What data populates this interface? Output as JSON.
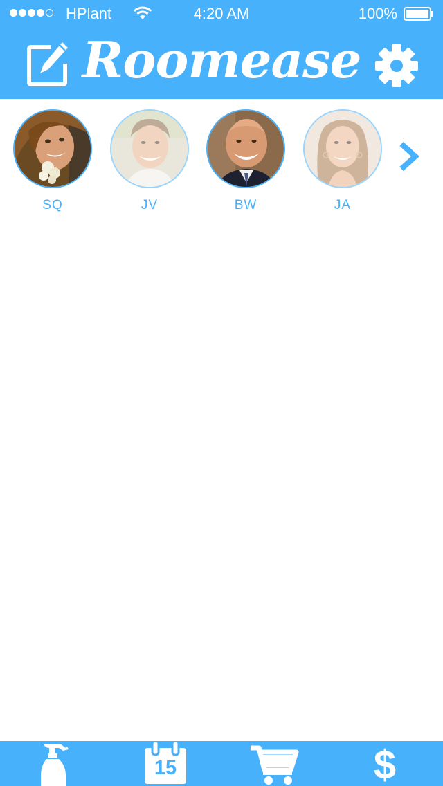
{
  "status_bar": {
    "carrier": "HPlant",
    "time": "4:20 AM",
    "battery": "100%",
    "signal_bars": 4,
    "signal_total": 5
  },
  "nav": {
    "title": "Roomease",
    "left_icon": "compose-icon",
    "right_icon": "gear-icon"
  },
  "roommates": [
    {
      "initials": "SQ",
      "icon": "avatar-photo"
    },
    {
      "initials": "JV",
      "icon": "avatar-photo"
    },
    {
      "initials": "BW",
      "icon": "avatar-photo"
    },
    {
      "initials": "JA",
      "icon": "avatar-photo"
    }
  ],
  "tabs": [
    {
      "icon": "spray-bottle-icon"
    },
    {
      "icon": "calendar-icon",
      "label": "15"
    },
    {
      "icon": "shopping-cart-icon"
    },
    {
      "icon": "dollar-icon",
      "label": "$"
    }
  ],
  "colors": {
    "accent": "#47b1fc",
    "background": "#ffffff"
  }
}
